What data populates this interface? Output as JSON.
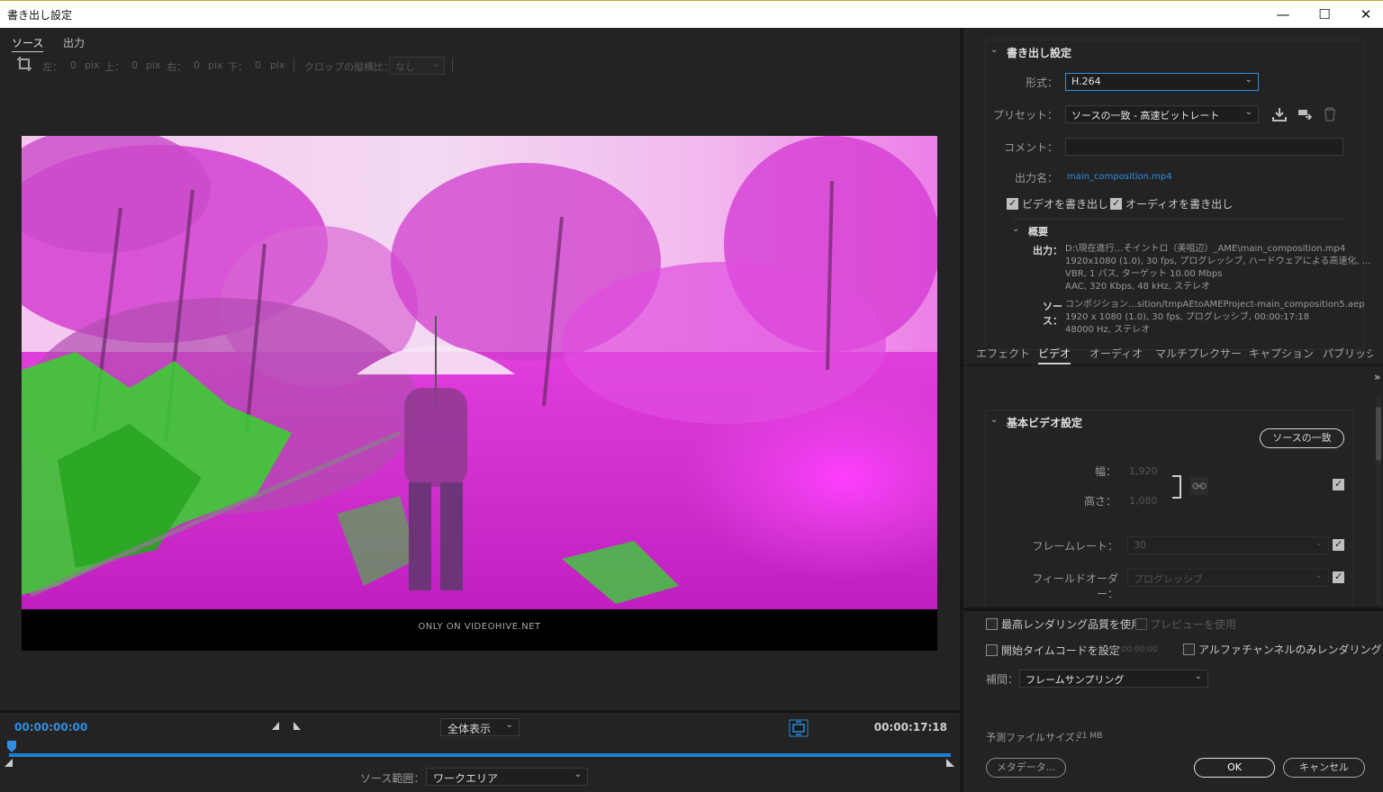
{
  "window": {
    "title": "書き出し設定",
    "minimize": "—",
    "maximize": "☐",
    "close": "✕"
  },
  "left": {
    "tabs": [
      {
        "label": "ソース"
      },
      {
        "label": "出力"
      }
    ],
    "crop": {
      "left_label": "左：",
      "left_value": "0",
      "top_label": "上：",
      "top_value": "0",
      "right_label": "右：",
      "right_value": "0",
      "bottom_label": "下：",
      "bottom_value": "0",
      "unit": "pix",
      "aspect_label": "クロップの縦横比：",
      "aspect_value": "なし"
    },
    "preview": {
      "watermark": "ONLY ON VIDEOHIVE.NET"
    },
    "timeline": {
      "start_timecode": "00:00:00:00",
      "end_timecode": "00:00:17:18",
      "fit_label": "全体表示",
      "range_label": "ソース範囲：",
      "range_value": "ワークエリア"
    }
  },
  "export": {
    "section_title": "書き出し設定",
    "format_label": "形式：",
    "format_value": "H.264",
    "preset_label": "プリセット：",
    "preset_value": "ソースの一致 - 高速ビットレート",
    "comment_label": "コメント：",
    "comment_value": "",
    "output_name_label": "出力名：",
    "output_name_value": "main_composition.mp4",
    "export_video_label": "ビデオを書き出し",
    "export_audio_label": "オーディオを書き出し",
    "summary_title": "概要",
    "summary_output_label": "出力：",
    "summary_output_lines": [
      "D:\\現在進行…そイントロ（美咀辺）_AME\\main_composition.mp4",
      "1920x1080 (1.0), 30 fps, プログレッシブ, ハードウェアによる高速化, ...",
      "VBR, 1 パス, ターゲット 10.00 Mbps",
      "AAC, 320 Kbps, 48 kHz, ステレオ"
    ],
    "summary_source_label": "ソース：",
    "summary_source_lines": [
      "コンポジション…sition/tmpAEtoAMEProject-main_composition5.aep",
      "1920 x 1080 (1.0), 30 fps, プログレッシブ, 00:00:17:18",
      "48000 Hz, ステレオ"
    ]
  },
  "tabs": [
    {
      "label": "エフェクト"
    },
    {
      "label": "ビデオ"
    },
    {
      "label": "オーディオ"
    },
    {
      "label": "マルチプレクサー"
    },
    {
      "label": "キャプション"
    },
    {
      "label": "パブリッシュ"
    }
  ],
  "video": {
    "section_title": "基本ビデオ設定",
    "match_source_button": "ソースの一致",
    "width_label": "幅：",
    "width_value": "1,920",
    "height_label": "高さ：",
    "height_value": "1,080",
    "frame_rate_label": "フレームレート：",
    "frame_rate_value": "30",
    "field_order_label": "フィールドオーダー：",
    "field_order_value": "プログレッシブ"
  },
  "bottom": {
    "max_quality_label": "最高レンダリング品質を使用",
    "use_previews_label": "プレビューを使用",
    "set_start_tc_label": "開始タイムコードを設定",
    "start_tc_value": "00:00:00:00",
    "alpha_only_label": "アルファチャンネルのみレンダリング",
    "interp_label": "補間：",
    "interp_value": "フレームサンプリング",
    "est_size_label": "予測ファイルサイズ：",
    "est_size_value": "21 MB",
    "metadata_button": "メタデータ...",
    "ok_button": "OK",
    "cancel_button": "キャンセル"
  }
}
